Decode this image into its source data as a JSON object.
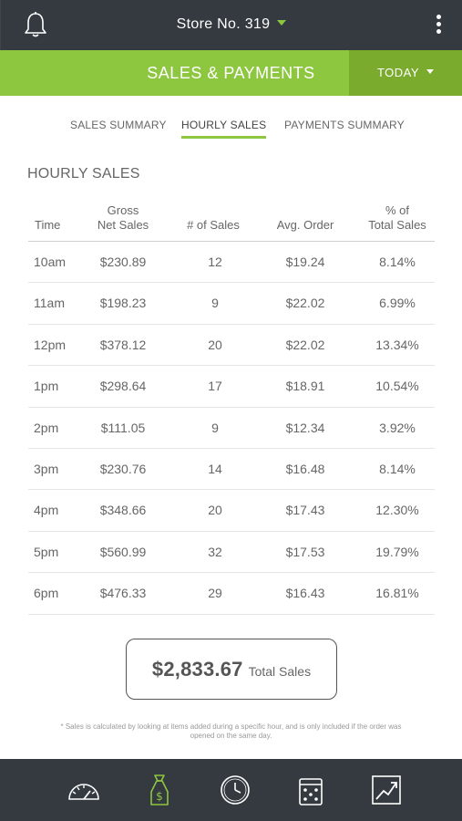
{
  "header": {
    "store_name": "Store No. 319",
    "icons": {
      "left": "bell-icon",
      "right": "more-vertical-icon"
    }
  },
  "subheader": {
    "title": "SALES & PAYMENTS",
    "period_label": "TODAY"
  },
  "tabs": [
    {
      "label": "SALES SUMMARY",
      "active": false
    },
    {
      "label": "HOURLY SALES",
      "active": true
    },
    {
      "label": "PAYMENTS SUMMARY",
      "active": false
    }
  ],
  "section_title": "HOURLY SALES",
  "table": {
    "headers": {
      "time": "Time",
      "gross_line1": "Gross",
      "gross_line2": "Net Sales",
      "num_sales": "# of Sales",
      "avg_order": "Avg. Order",
      "pct_line1": "% of",
      "pct_line2": "Total Sales"
    },
    "rows": [
      {
        "time": "10am",
        "sales": "$230.89",
        "count": "12",
        "avg": "$19.24",
        "pct": "8.14%"
      },
      {
        "time": "11am",
        "sales": "$198.23",
        "count": "9",
        "avg": "$22.02",
        "pct": "6.99%"
      },
      {
        "time": "12pm",
        "sales": "$378.12",
        "count": "20",
        "avg": "$22.02",
        "pct": "13.34%"
      },
      {
        "time": "1pm",
        "sales": "$298.64",
        "count": "17",
        "avg": "$18.91",
        "pct": "10.54%"
      },
      {
        "time": "2pm",
        "sales": "$111.05",
        "count": "9",
        "avg": "$12.34",
        "pct": "3.92%"
      },
      {
        "time": "3pm",
        "sales": "$230.76",
        "count": "14",
        "avg": "$16.48",
        "pct": "8.14%"
      },
      {
        "time": "4pm",
        "sales": "$348.66",
        "count": "20",
        "avg": "$17.43",
        "pct": "12.30%"
      },
      {
        "time": "5pm",
        "sales": "$560.99",
        "count": "32",
        "avg": "$17.53",
        "pct": "19.79%"
      },
      {
        "time": "6pm",
        "sales": "$476.33",
        "count": "29",
        "avg": "$16.43",
        "pct": "16.81%"
      }
    ]
  },
  "total": {
    "amount": "$2,833.67",
    "label": "Total Sales"
  },
  "footnote": "* Sales is calculated by looking at items added during a specific hour, and is only included if the order was opened on the same day.",
  "bottom_nav": [
    {
      "icon": "speedometer-icon",
      "active": false
    },
    {
      "icon": "money-bag-icon",
      "active": true
    },
    {
      "icon": "clock-icon",
      "active": false
    },
    {
      "icon": "cash-register-icon",
      "active": false
    },
    {
      "icon": "trend-chart-icon",
      "active": false
    }
  ],
  "colors": {
    "accent": "#8dc63f",
    "accent_dark": "#7aab2c",
    "bar": "#343a40"
  }
}
